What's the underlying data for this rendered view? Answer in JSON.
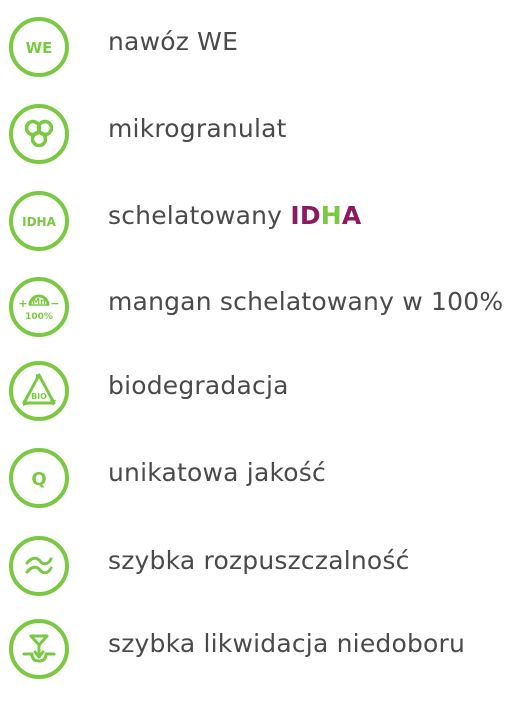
{
  "features": [
    {
      "label": "nawóz WE",
      "icon": "we-icon",
      "icon_text": "WE"
    },
    {
      "label": "mikrogranulat",
      "icon": "microgranule-icon"
    },
    {
      "label_prefix": "schelatowany ",
      "icon": "idha-icon",
      "icon_text": "IDHA",
      "idha_letters": [
        "I",
        "D",
        "H",
        "A"
      ]
    },
    {
      "label": "mangan schelatowany w 100%",
      "icon": "manganese-chelate-icon",
      "icon_text_top": "Mn",
      "icon_text_bottom": "100%",
      "icon_plus": "+",
      "icon_minus": "−"
    },
    {
      "label": "biodegradacja",
      "icon": "biodegradation-icon",
      "icon_text": "BIO"
    },
    {
      "label": "unikatowa jakość",
      "icon": "quality-icon",
      "icon_text": "Q"
    },
    {
      "label": "szybka rozpuszczalność",
      "icon": "solubility-icon"
    },
    {
      "label": "szybka likwidacja niedoboru",
      "icon": "deficiency-icon"
    }
  ],
  "colors": {
    "accent_green": "#7ac943",
    "brand_purple": "#8b1a5e",
    "text_gray": "#4a4a4a"
  }
}
